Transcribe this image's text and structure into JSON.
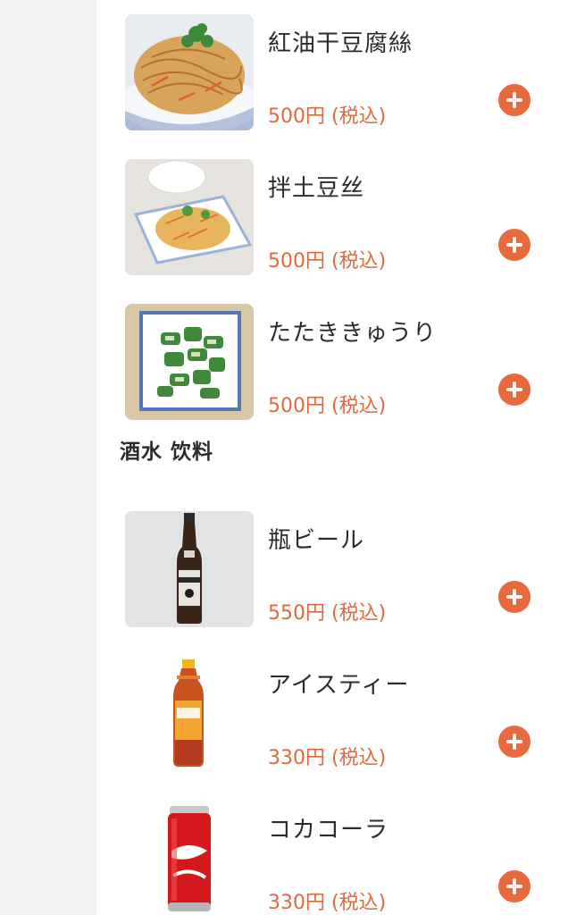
{
  "menu": {
    "items_top": [
      {
        "name": "紅油干豆腐絲",
        "price": "500円 (税込)",
        "icon": "noodle-salad-image"
      },
      {
        "name": "拌土豆丝",
        "price": "500円 (税込)",
        "icon": "potato-salad-image"
      },
      {
        "name": "たたききゅうり",
        "price": "500円 (税込)",
        "icon": "cucumber-salad-image"
      }
    ],
    "section_title": "酒水 饮料",
    "items_drinks": [
      {
        "name": "瓶ビール",
        "price": "550円 (税込)",
        "icon": "beer-bottle-image"
      },
      {
        "name": "アイスティー",
        "price": "330円 (税込)",
        "icon": "iced-tea-bottle-image"
      },
      {
        "name": "コカコーラ",
        "price": "330円 (税込)",
        "icon": "cola-can-image"
      }
    ]
  },
  "colors": {
    "accent": "#e8693d",
    "price": "#e2683c",
    "text": "#2b2b2b",
    "gutter": "#f3f3f3",
    "content_bg": "#ffffff"
  }
}
